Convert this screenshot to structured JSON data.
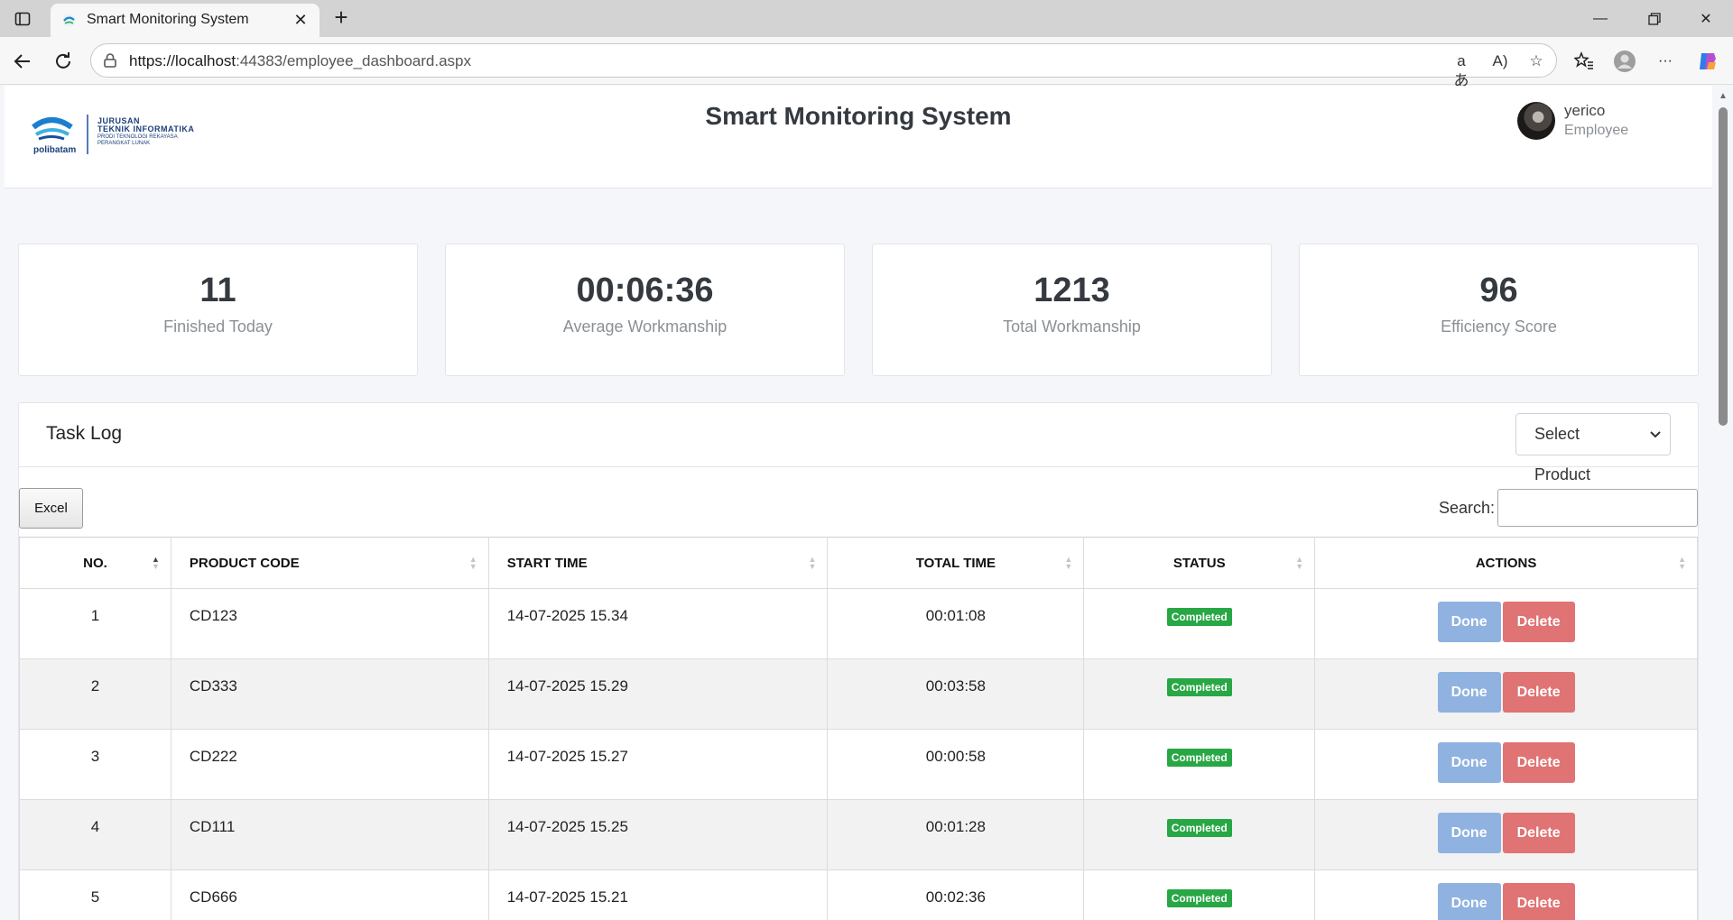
{
  "browser": {
    "tab_title": "Smart Monitoring System",
    "url_host": "https://localhost",
    "url_rest": ":44383/employee_dashboard.aspx"
  },
  "header": {
    "title": "Smart Monitoring System",
    "logo_text": "polibatam",
    "dept_line1": "JURUSAN",
    "dept_line2": "TEKNIK INFORMATIKA",
    "dept_line3": "PRODI TEKNOLOGI REKAYASA",
    "dept_line4": "PERANGKAT LUNAK",
    "user_name": "yerico",
    "user_role": "Employee"
  },
  "stats": [
    {
      "value": "11",
      "label": "Finished Today"
    },
    {
      "value": "00:06:36",
      "label": "Average Workmanship"
    },
    {
      "value": "1213",
      "label": "Total Workmanship"
    },
    {
      "value": "96",
      "label": "Efficiency Score"
    }
  ],
  "task_log": {
    "title": "Task Log",
    "product_select": "Select Product",
    "excel_label": "Excel",
    "search_label": "Search:",
    "search_value": "",
    "columns": [
      "NO.",
      "PRODUCT CODE",
      "START TIME",
      "TOTAL TIME",
      "STATUS",
      "ACTIONS"
    ],
    "done_label": "Done",
    "delete_label": "Delete",
    "rows": [
      {
        "no": "1",
        "code": "CD123",
        "start": "14-07-2025 15.34",
        "total": "00:01:08",
        "status": "Completed"
      },
      {
        "no": "2",
        "code": "CD333",
        "start": "14-07-2025 15.29",
        "total": "00:03:58",
        "status": "Completed"
      },
      {
        "no": "3",
        "code": "CD222",
        "start": "14-07-2025 15.27",
        "total": "00:00:58",
        "status": "Completed"
      },
      {
        "no": "4",
        "code": "CD111",
        "start": "14-07-2025 15.25",
        "total": "00:01:28",
        "status": "Completed"
      },
      {
        "no": "5",
        "code": "CD666",
        "start": "14-07-2025 15.21",
        "total": "00:02:36",
        "status": "Completed"
      }
    ]
  },
  "colors": {
    "status_completed": "#28a745",
    "done_button": "#8fb2e0",
    "delete_button": "#e07373"
  }
}
